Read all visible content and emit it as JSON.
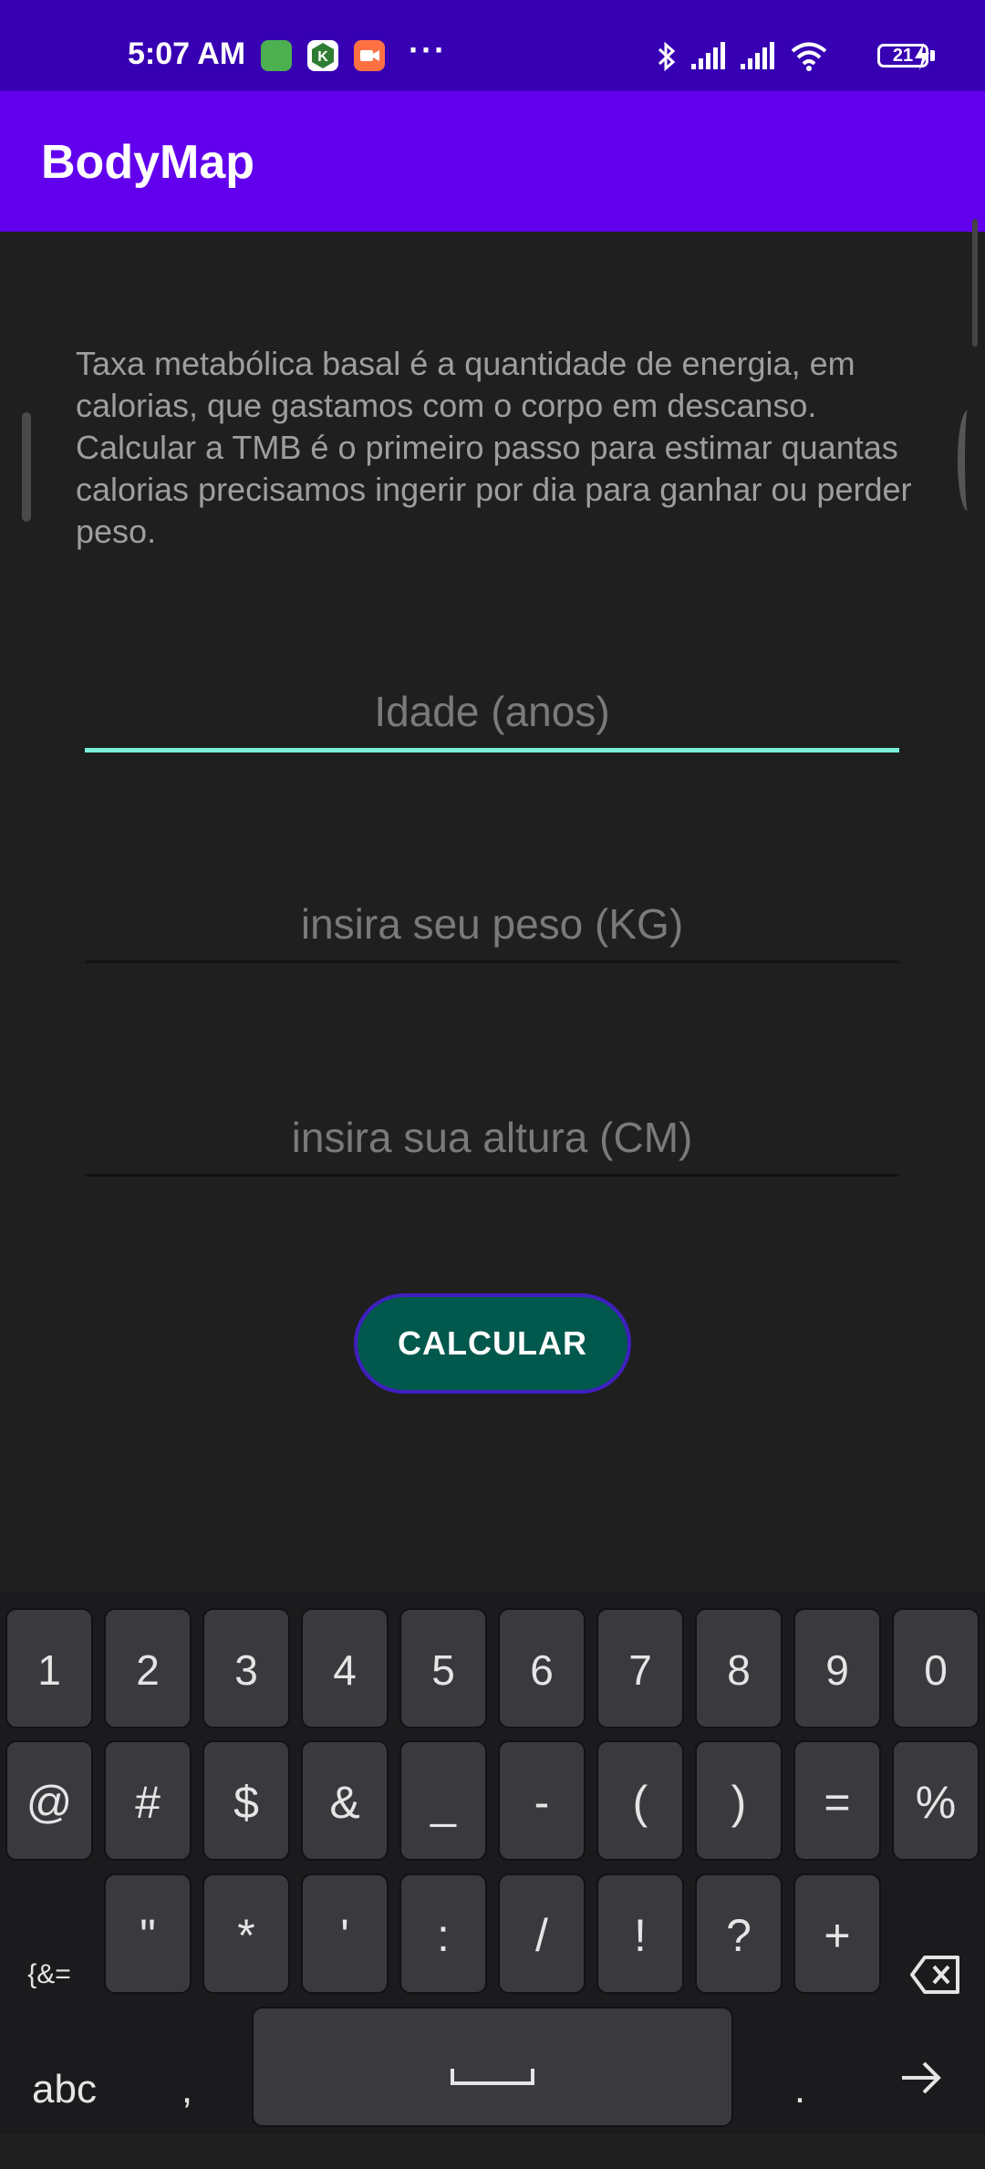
{
  "status_bar": {
    "time": "5:07 AM",
    "more": "···",
    "battery": "21",
    "icons": [
      "cat-notification-icon",
      "k-notification-icon",
      "video-notification-icon",
      "bluetooth-icon",
      "signal-icon",
      "signal-icon",
      "wifi-icon",
      "battery-icon",
      "charging-icon"
    ]
  },
  "app_bar": {
    "title": "BodyMap"
  },
  "main": {
    "description": "Taxa metabólica basal é a quantidade de energia, em calorias, que gastamos com o corpo em descanso. Calcular a TMB é o primeiro passo para estimar quantas calorias precisamos ingerir por dia para ganhar ou perder peso.",
    "fields": {
      "age_placeholder": "Idade (anos)",
      "weight_placeholder": "insira seu peso (KG)",
      "height_placeholder": "insira sua altura (CM)"
    },
    "button_label": "CALCULAR"
  },
  "colors": {
    "status_bar": "#3700b3",
    "app_bar": "#6200ee",
    "accent": "#03dac5",
    "button": "#01584c"
  },
  "keyboard": {
    "row1": [
      "1",
      "2",
      "3",
      "4",
      "5",
      "6",
      "7",
      "8",
      "9",
      "0"
    ],
    "row2": [
      "@",
      "#",
      "$",
      "&",
      "_",
      "-",
      "(",
      ")",
      "=",
      "%"
    ],
    "row3_left": "{&=",
    "row3": [
      "\"",
      "*",
      "'",
      ":",
      "/",
      "!",
      "?",
      "+"
    ],
    "row4_left": "abc",
    "comma": ",",
    "period": ".",
    "icons": [
      "backspace-icon",
      "space-icon",
      "next-arrow-icon"
    ]
  }
}
